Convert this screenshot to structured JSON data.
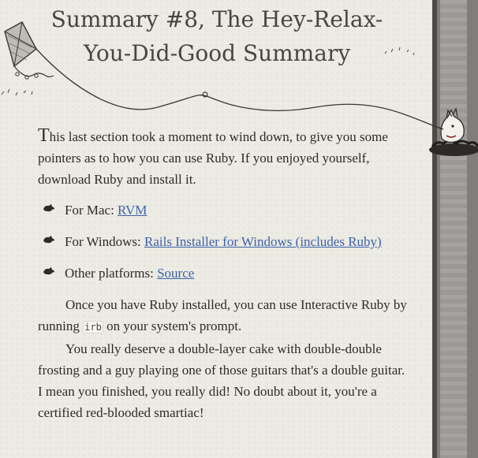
{
  "page": {
    "title": "Summary #8, The Hey-Relax-You-Did-Good Summary"
  },
  "intro": {
    "dropcap": "T",
    "text": "his last section took a moment to wind down, to give you some pointers as to how you can use Ruby. If you enjoyed yourself, download Ruby and install it."
  },
  "platforms": [
    {
      "label": "For Mac: ",
      "link": "RVM"
    },
    {
      "label": "For Windows: ",
      "link": "Rails Installer for Windows (includes Ruby)"
    },
    {
      "label": "Other platforms: ",
      "link": "Source"
    }
  ],
  "irb_paragraph": {
    "before": "Once you have Ruby installed, you can use Interactive Ruby by running ",
    "code": "irb",
    "after": " on your system's prompt."
  },
  "closing": "You really deserve a double-layer cake with double-double frosting and a guy playing one of those guitars that's a double guitar. I mean you finished, you really did! No doubt about it, you're a certified red-blooded smartiac!",
  "icons": {
    "kite": "kite-icon",
    "fox": "fox-icon",
    "bullet": "squirrel-bullet-icon"
  }
}
